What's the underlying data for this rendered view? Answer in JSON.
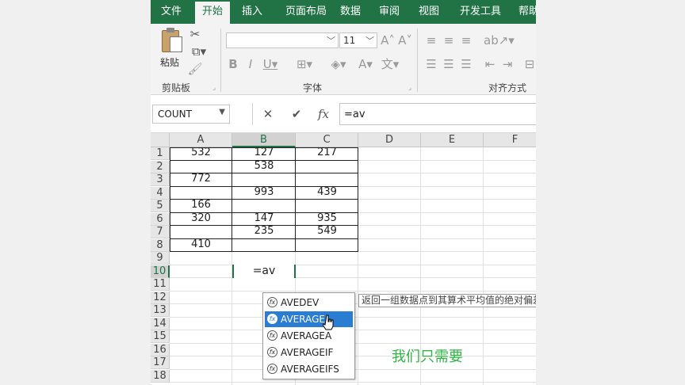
{
  "ribbon_tabs": [
    "文件",
    "开始",
    "插入",
    "页面布局",
    "数据",
    "审阅",
    "视图",
    "开发工具",
    "帮助"
  ],
  "active_tab": "开始",
  "clipboard": {
    "paste_label": "粘贴",
    "group_label": "剪贴板"
  },
  "font": {
    "name": "",
    "size": "11",
    "group_label": "字体"
  },
  "alignment": {
    "group_label": "对齐方式"
  },
  "name_box": "COUNT",
  "formula_bar": {
    "value": "=av"
  },
  "columns": [
    "A",
    "B",
    "C",
    "D",
    "E",
    "F"
  ],
  "selected_column": "B",
  "rows": [
    "1",
    "2",
    "3",
    "4",
    "5",
    "6",
    "7",
    "8",
    "9",
    "10",
    "11",
    "12",
    "13",
    "14",
    "15",
    "16",
    "17",
    "18"
  ],
  "selected_row": "10",
  "cells": {
    "A1": "532",
    "B1": "127",
    "C1": "217",
    "B2": "538",
    "A3": "772",
    "B4": "993",
    "C4": "439",
    "A5": "166",
    "A6": "320",
    "B6": "147",
    "C6": "935",
    "B7": "235",
    "C7": "549",
    "A8": "410"
  },
  "active_cell": {
    "ref": "B10",
    "value": "=av"
  },
  "autocomplete": [
    "AVEDEV",
    "AVERAGE",
    "AVERAGEA",
    "AVERAGEIF",
    "AVERAGEIFS"
  ],
  "autocomplete_selected": "AVERAGE",
  "tooltip": "返回一组数据点到其算术平均值的绝对偏差",
  "caption": "我们只需要",
  "colors": {
    "accent": "#217346",
    "highlight": "#2b7cd3",
    "caption": "#2fb344"
  }
}
